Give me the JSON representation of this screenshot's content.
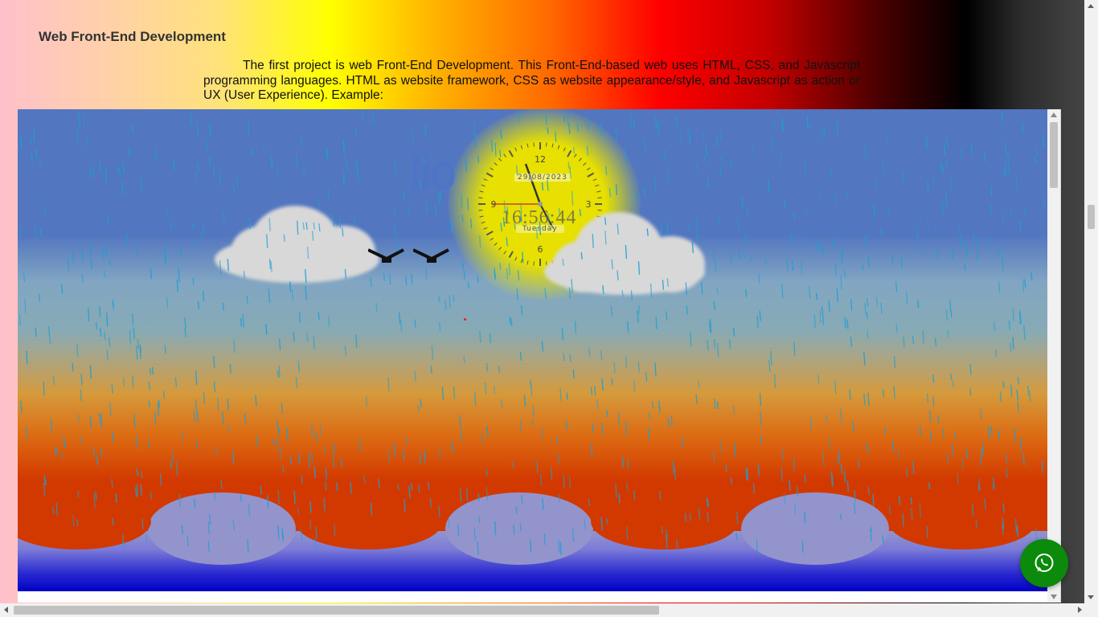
{
  "section": {
    "title": "Web Front-End Development",
    "description": "The first project is web Front-End Development. This Front-End-based web uses HTML, CSS, and Javascript programming languages. HTML as website framework, CSS as website appearance/style, and Javascript as action or UX (User Experience). Example:"
  },
  "demo": {
    "heading_fragment": "lio",
    "clock": {
      "date": "29/08/2023",
      "time": "16:56:44",
      "day": "Tuesday",
      "numerals": [
        "12",
        "3",
        "6",
        "9"
      ]
    }
  },
  "floating_button": {
    "icon": "whatsapp-icon",
    "color": "#0b8a0b"
  },
  "colors": {
    "sky": "#5276bf",
    "sun": "#e7e000",
    "ground": "#d23900",
    "sea": "#0000c8"
  }
}
